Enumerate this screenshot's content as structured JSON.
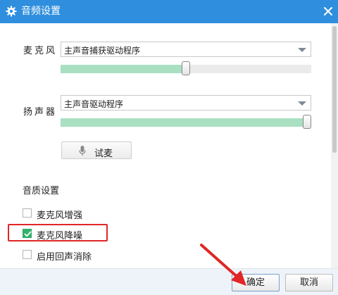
{
  "window": {
    "title": "音频设置",
    "title_icon": "gear-icon",
    "close_icon": "close-icon",
    "titlebar_color": "#2f8fde"
  },
  "microphone": {
    "label": "麦克风",
    "device": "主声音捕获驱动程序",
    "volume_fraction": 0.5
  },
  "speaker": {
    "label": "扬声器",
    "device": "主声音驱动程序",
    "volume_fraction": 1.0
  },
  "test_button": {
    "label": "试麦",
    "icon": "microphone-icon"
  },
  "quality": {
    "title": "音质设置",
    "options": [
      {
        "label": "麦克风增强",
        "checked": false
      },
      {
        "label": "麦克风降噪",
        "checked": true
      },
      {
        "label": "启用回声消除",
        "checked": false
      }
    ]
  },
  "footer": {
    "ok_label": "确定",
    "cancel_label": "取消"
  },
  "colors": {
    "slider_fill": "#a8e0c1",
    "checkbox_checked": "#32b36d",
    "highlight": "#e02626"
  }
}
